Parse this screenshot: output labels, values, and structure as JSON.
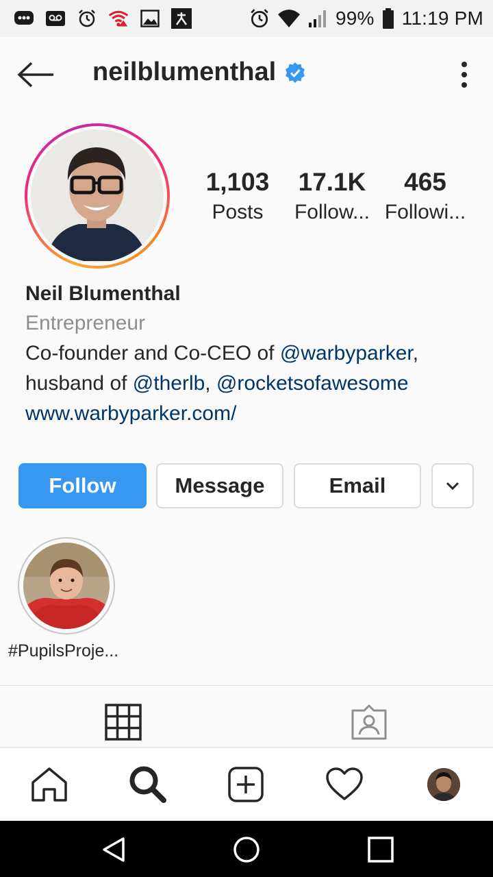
{
  "status_bar": {
    "battery_percent": "99%",
    "time": "11:19 PM"
  },
  "header": {
    "username": "neilblumenthal",
    "verified": true
  },
  "stats": [
    {
      "value": "1,103",
      "label": "Posts"
    },
    {
      "value": "17.1K",
      "label": "Follow..."
    },
    {
      "value": "465",
      "label": "Followi..."
    }
  ],
  "bio": {
    "name": "Neil Blumenthal",
    "category": "Entrepreneur",
    "line1_text": "Co-founder and Co-CEO of ",
    "line1_mention": "@warbyparker",
    "line1_suffix": ",",
    "line2_text": "husband of ",
    "line2_mention1": "@therlb",
    "line2_sep": ", ",
    "line2_mention2": "@rocketsofawesome",
    "website": "www.warbyparker.com/"
  },
  "actions": {
    "follow_label": "Follow",
    "message_label": "Message",
    "email_label": "Email"
  },
  "highlights": [
    {
      "label": "#PupilsProje..."
    }
  ],
  "colors": {
    "accent": "#3897f0",
    "link": "#003569",
    "muted": "#8e8e8e",
    "border": "#dbdbdb"
  },
  "icons": {
    "status_left": [
      "messenger-icon",
      "voicemail-icon",
      "alarm-icon",
      "wifi-alert-icon",
      "gallery-icon",
      "fitness-app-icon"
    ],
    "status_right": [
      "alarm-icon",
      "wifi-icon",
      "signal-icon",
      "battery-icon"
    ],
    "tabs": [
      "grid-icon",
      "tagged-icon"
    ],
    "bottom_nav": [
      "home-icon",
      "search-icon",
      "new-post-icon",
      "activity-icon",
      "profile-avatar"
    ],
    "system_nav": [
      "back-icon",
      "home-circle-icon",
      "recents-icon"
    ]
  }
}
